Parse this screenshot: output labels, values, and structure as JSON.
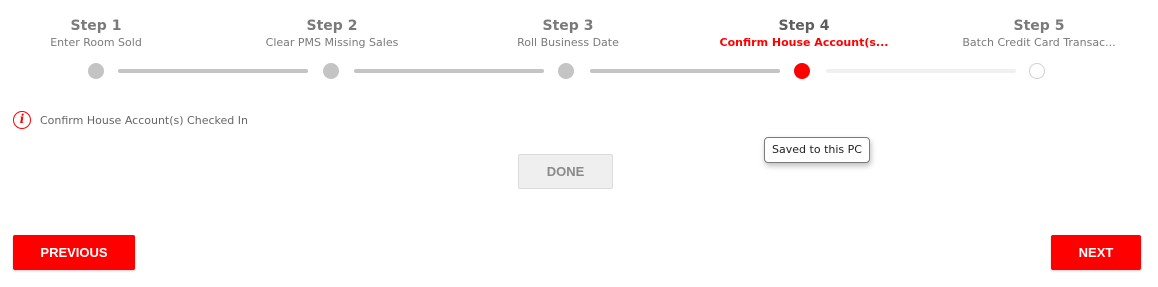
{
  "stepper": {
    "steps": [
      {
        "title": "Step 1",
        "subtitle": "Enter Room Sold",
        "state": "completed"
      },
      {
        "title": "Step 2",
        "subtitle": "Clear PMS Missing Sales",
        "state": "completed"
      },
      {
        "title": "Step 3",
        "subtitle": "Roll Business Date",
        "state": "completed"
      },
      {
        "title": "Step 4",
        "subtitle": "Confirm House Account(s...",
        "state": "active"
      },
      {
        "title": "Step 5",
        "subtitle": "Batch Credit Card Transac...",
        "state": "pending"
      }
    ],
    "current_step": 4,
    "total_steps": 5
  },
  "colors": {
    "accent": "#ff0000",
    "completed_dot": "#c4c4c4",
    "track": "#c4c4c4",
    "track_pending": "#f0f0f0"
  },
  "info": {
    "icon": "info-icon",
    "icon_glyph": "i",
    "message": "Confirm House Account(s) Checked In"
  },
  "tooltip": {
    "text": "Saved to this PC"
  },
  "actions": {
    "done_label": "DONE",
    "previous_label": "PREVIOUS",
    "next_label": "NEXT"
  }
}
